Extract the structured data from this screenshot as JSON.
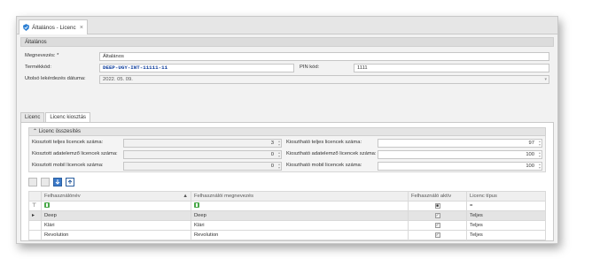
{
  "tab": {
    "title": "Általános - Licenc",
    "close": "×"
  },
  "section": {
    "title": "Általános"
  },
  "form": {
    "name_label": "Megnevezés: *",
    "name_value": "Általános",
    "product_label": "Termékkód:",
    "product_value": "DEEP-UGY-INT-11111-11",
    "pin_label": "PIN kód:",
    "pin_value": "1111",
    "last_query_label": "Utolsó lekérdezés dátuma:",
    "last_query_value": "2022. 05. 09."
  },
  "inner_tabs": [
    "Licenc",
    "Licenc kiosztás"
  ],
  "summary": {
    "title": "Licenc összesítés",
    "assigned_total_label": "Kiosztott teljes licencek száma:",
    "assigned_total": "3",
    "assigned_data_label": "Kiosztott adatelemző licencek száma:",
    "assigned_data": "0",
    "assigned_mobile_label": "Kiosztott mobil licencek száma:",
    "assigned_mobile": "0",
    "avail_total_label": "Kiosztható teljes licencek száma:",
    "avail_total": "97",
    "avail_data_label": "Kiosztható adatelemző licencek száma:",
    "avail_data": "100",
    "avail_mobile_label": "Kiosztható mobil licencek száma:",
    "avail_mobile": "100"
  },
  "grid": {
    "col_user": "Felhasználónév",
    "col_name": "Felhasználói megnevezés",
    "col_active": "Felhasználó aktív",
    "col_type": "Licenc típus",
    "filter_type": "=",
    "rows": [
      {
        "user": "Deep",
        "name": "Deep",
        "type": "Teljes"
      },
      {
        "user": "Klári",
        "name": "Klári",
        "type": "Teljes"
      },
      {
        "user": "Revolution",
        "name": "Revolution",
        "type": "Teljes"
      }
    ]
  },
  "colors": {
    "product_code": "#0b3b9b",
    "accent": "#3a79c9"
  }
}
